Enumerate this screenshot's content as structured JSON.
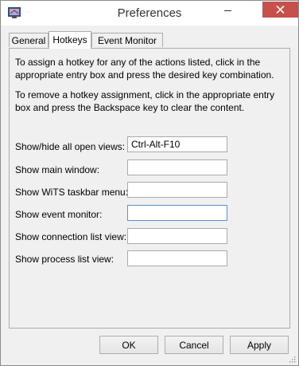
{
  "window": {
    "title": "Preferences"
  },
  "tabs": [
    {
      "label": "General",
      "active": false
    },
    {
      "label": "Hotkeys",
      "active": true
    },
    {
      "label": "Event Monitor",
      "active": false
    }
  ],
  "hotkeys": {
    "instructions": [
      "To assign a hotkey for any of the actions listed, click in the appropriate entry box and press the desired key combination.",
      "To remove a hotkey assignment, click in the appropriate entry box and press the Backspace key to clear the content."
    ],
    "rows": [
      {
        "label": "Show/hide all open views:",
        "value": "Ctrl-Alt-F10"
      },
      {
        "label": "Show main window:",
        "value": ""
      },
      {
        "label": "Show WiTS taskbar menu:",
        "value": ""
      },
      {
        "label": "Show event monitor:",
        "value": "",
        "focused": true
      },
      {
        "label": "Show connection list view:",
        "value": ""
      },
      {
        "label": "Show process list view:",
        "value": ""
      }
    ]
  },
  "buttons": {
    "ok": "OK",
    "cancel": "Cancel",
    "apply": "Apply"
  },
  "colors": {
    "close_button": "#c7504b",
    "focus_border": "#5a8fd6",
    "dialog_background": "#f0f0f0"
  }
}
